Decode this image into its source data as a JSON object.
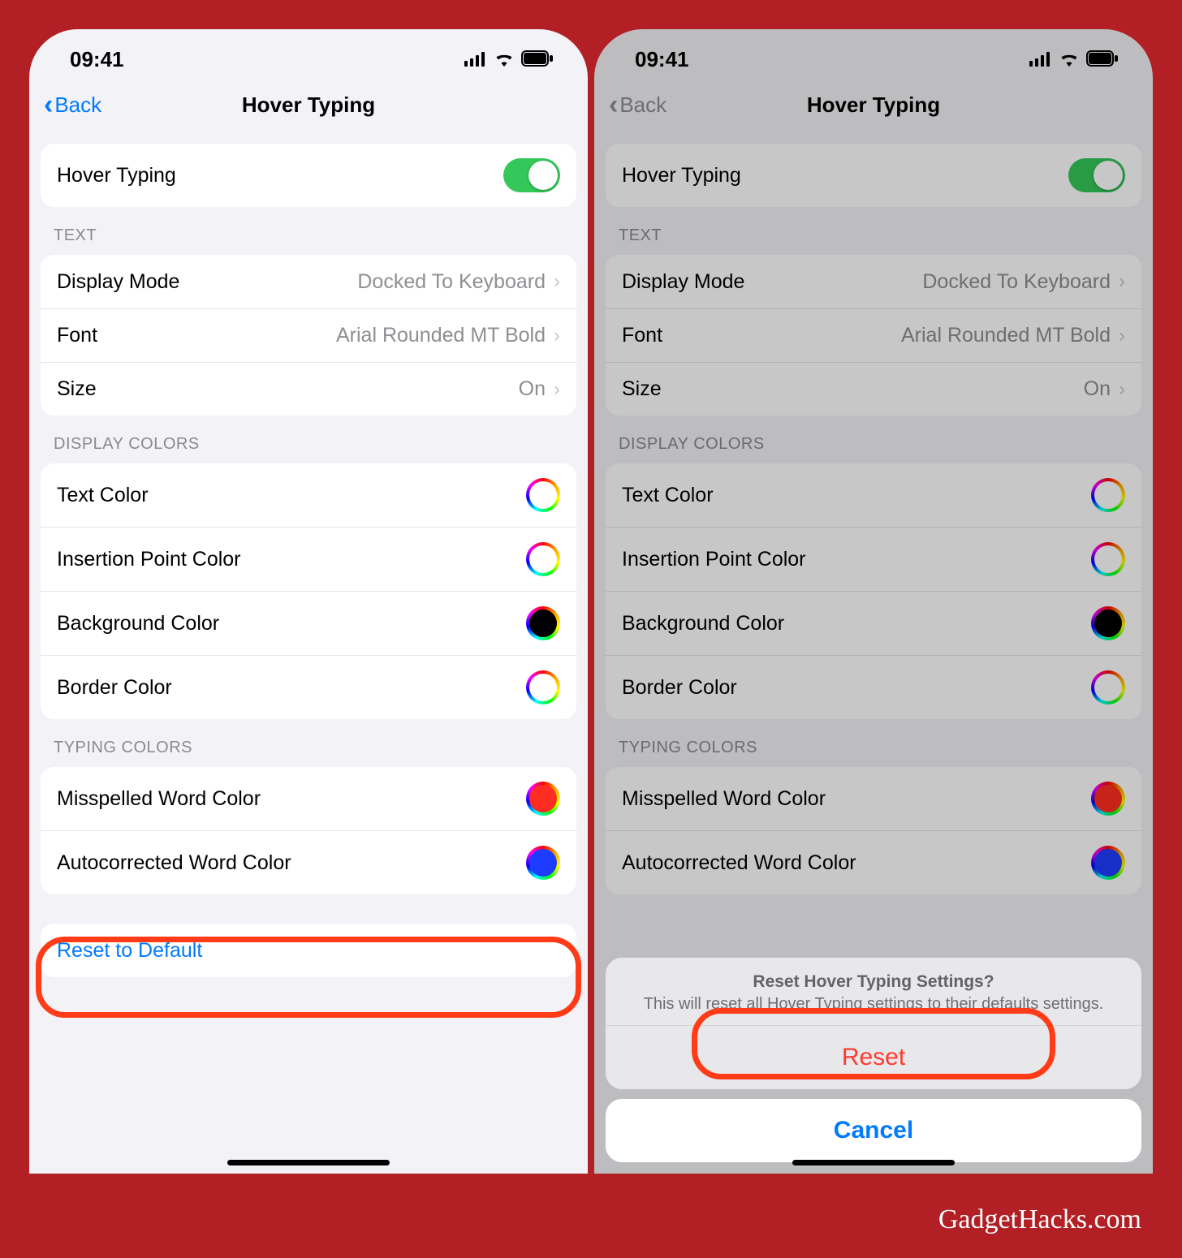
{
  "watermark": "GadgetHacks.com",
  "statusbar": {
    "time": "09:41"
  },
  "nav": {
    "back": "Back",
    "title": "Hover Typing"
  },
  "toggle": {
    "label": "Hover Typing",
    "on": true
  },
  "sections": {
    "text": {
      "header": "TEXT",
      "displayMode": {
        "label": "Display Mode",
        "value": "Docked To Keyboard"
      },
      "font": {
        "label": "Font",
        "value": "Arial Rounded MT Bold"
      },
      "size": {
        "label": "Size",
        "value": "On"
      }
    },
    "displayColors": {
      "header": "DISPLAY COLORS",
      "textColor": "Text Color",
      "insertionPoint": "Insertion Point Color",
      "background": "Background Color",
      "border": "Border Color"
    },
    "typingColors": {
      "header": "TYPING COLORS",
      "misspelled": "Misspelled Word Color",
      "autocorrected": "Autocorrected Word Color"
    }
  },
  "reset": {
    "label": "Reset to Default"
  },
  "sheet": {
    "title": "Reset Hover Typing Settings?",
    "message": "This will reset all Hover Typing settings to their defaults settings.",
    "reset": "Reset",
    "cancel": "Cancel"
  }
}
